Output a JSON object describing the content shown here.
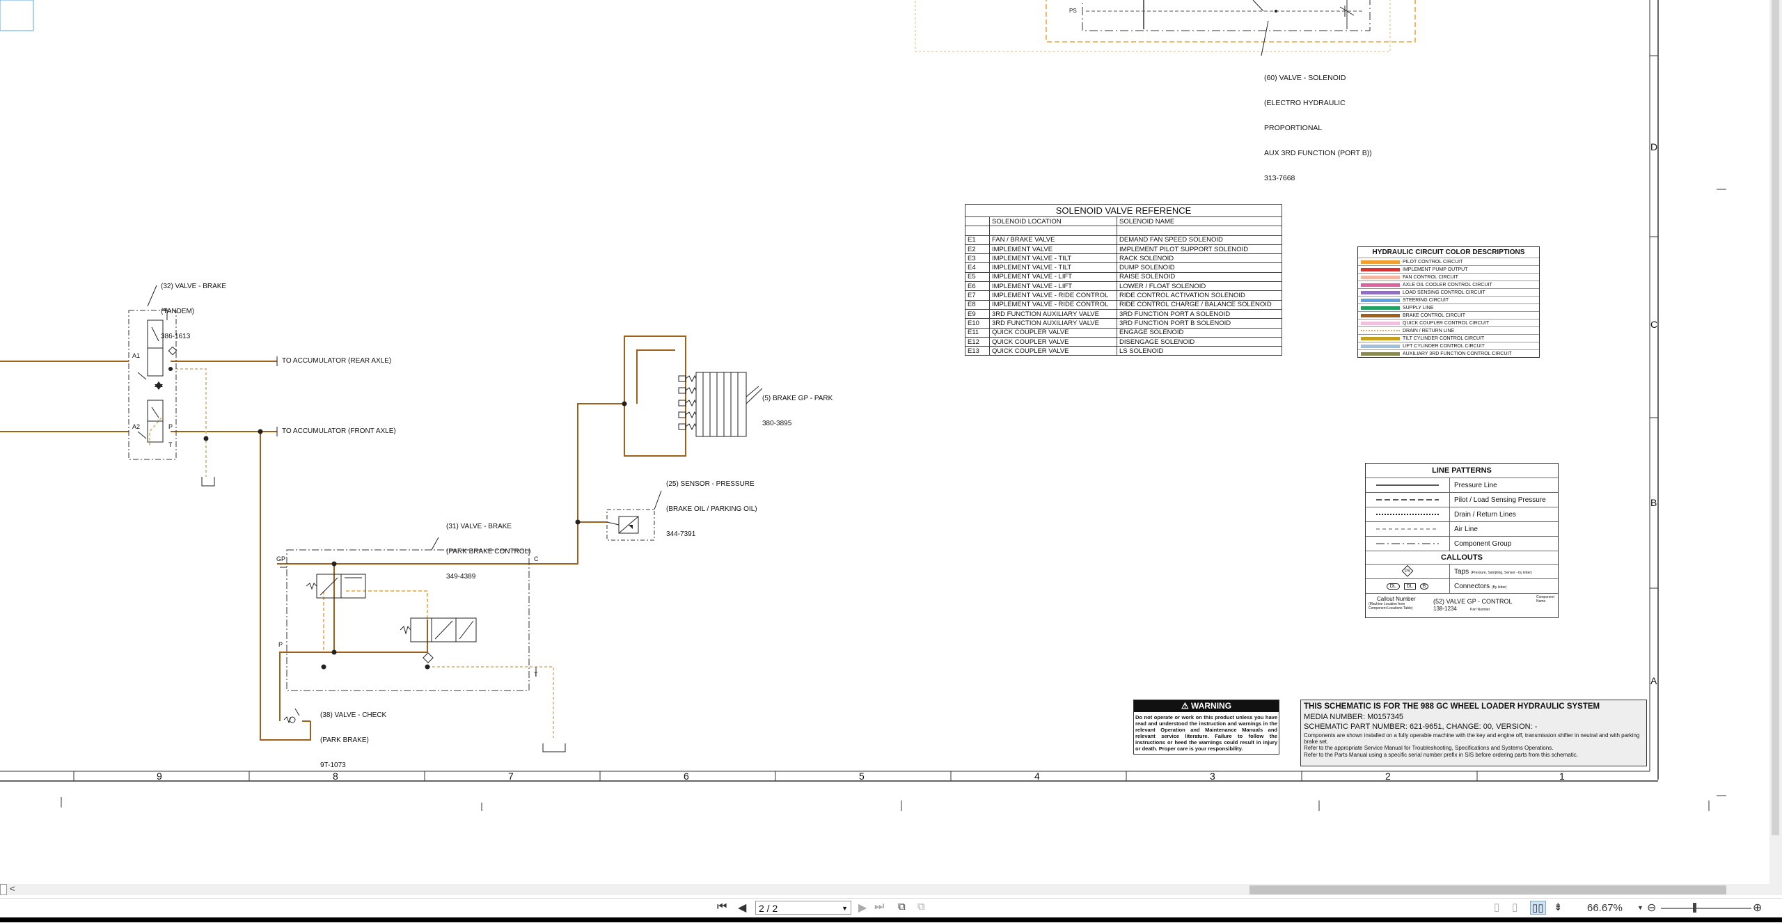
{
  "callouts": {
    "valve_solenoid_60": [
      "(60) VALVE - SOLENOID",
      "(ELECTRO HYDRAULIC",
      "PROPORTIONAL",
      "AUX 3RD FUNCTION (PORT B))",
      "313-7668"
    ],
    "valve_brake_32": [
      "(32) VALVE - BRAKE",
      "(TANDEM)",
      "386-1613"
    ],
    "accum_rear": "TO ACCUMULATOR (REAR AXLE)",
    "accum_front": "TO ACCUMULATOR (FRONT AXLE)",
    "brake_gp_park": [
      "(5) BRAKE GP - PARK",
      "380-3895"
    ],
    "sensor_pressure": [
      "(25) SENSOR - PRESSURE",
      "(BRAKE OIL / PARKING OIL)",
      "344-7391"
    ],
    "valve_brake_31": [
      "(31) VALVE - BRAKE",
      "(PARK BRAKE CONTROL)",
      "349-4389"
    ],
    "valve_check_38": [
      "(38) VALVE - CHECK",
      "(PARK BRAKE)",
      "9T-1073"
    ],
    "ports": {
      "a1": "A1",
      "a2": "A2",
      "p": "P",
      "t": "T",
      "gp": "GP",
      "c": "C",
      "ps": "PS"
    }
  },
  "solenoid_table": {
    "title": "SOLENOID VALVE REFERENCE",
    "col1": "SOLENOID LOCATION",
    "col2": "SOLENOID NAME",
    "rows": [
      [
        "E1",
        "FAN / BRAKE VALVE",
        "DEMAND FAN SPEED SOLENOID"
      ],
      [
        "E2",
        "IMPLEMENT VALVE",
        "IMPLEMENT PILOT SUPPORT SOLENOID"
      ],
      [
        "E3",
        "IMPLEMENT VALVE - TILT",
        "RACK SOLENOID"
      ],
      [
        "E4",
        "IMPLEMENT VALVE - TILT",
        "DUMP SOLENOID"
      ],
      [
        "E5",
        "IMPLEMENT VALVE - LIFT",
        "RAISE SOLENOID"
      ],
      [
        "E6",
        "IMPLEMENT VALVE - LIFT",
        "LOWER / FLOAT SOLENOID"
      ],
      [
        "E7",
        "IMPLEMENT VALVE - RIDE CONTROL",
        "RIDE CONTROL ACTIVATION SOLENOID"
      ],
      [
        "E8",
        "IMPLEMENT VALVE - RIDE CONTROL",
        "RIDE CONTROL CHARGE / BALANCE SOLENOID"
      ],
      [
        "E9",
        "3RD FUNCTION AUXILIARY VALVE",
        "3RD FUNCTION PORT A SOLENOID"
      ],
      [
        "E10",
        "3RD FUNCTION AUXILIARY VALVE",
        "3RD FUNCTION PORT B SOLENOID"
      ],
      [
        "E11",
        "QUICK COUPLER VALVE",
        "ENGAGE SOLENOID"
      ],
      [
        "E12",
        "QUICK COUPLER VALVE",
        "DISENGAGE SOLENOID"
      ],
      [
        "E13",
        "QUICK COUPLER VALVE",
        "LS SOLENOID"
      ]
    ]
  },
  "color_legend": {
    "title": "HYDRAULIC CIRCUIT COLOR DESCRIPTIONS",
    "items": [
      {
        "label": "PILOT CONTROL CIRCUIT",
        "color": "#f0a030"
      },
      {
        "label": "IMPLEMENT PUMP OUTPUT",
        "color": "#e03030"
      },
      {
        "label": "FAN CONTROL CIRCUIT",
        "color": "#f4b6a0"
      },
      {
        "label": "AXLE OIL COOLER CONTROL CIRCUIT",
        "color": "#e060a0"
      },
      {
        "label": "LOAD SENSING CONTROL CIRCUIT",
        "color": "#9070c0"
      },
      {
        "label": "STEERING CIRCUIT",
        "color": "#60a0e0"
      },
      {
        "label": "SUPPLY LINE",
        "color": "#20a060"
      },
      {
        "label": "BRAKE CONTROL CIRCUIT",
        "color": "#a0601a"
      },
      {
        "label": "QUICK COUPLER CONTROL CIRCUIT",
        "color": "#f0c0e0"
      },
      {
        "label": "DRAIN / RETURN LINE",
        "color": "#d0b070"
      },
      {
        "label": "TILT CYLINDER CONTROL CIRCUIT",
        "color": "#c8a020"
      },
      {
        "label": "LIFT CYLINDER CONTROL CIRCUIT",
        "color": "#a0c0e0"
      },
      {
        "label": "AUXILIARY 3RD FUNCTION CONTROL CIRCUIT",
        "color": "#8a8a50"
      }
    ]
  },
  "line_patterns": {
    "title": "LINE PATTERNS",
    "items": [
      "Pressure Line",
      "Pilot / Load Sensing Pressure",
      "Drain / Return Lines",
      "Air Line",
      "Component Group"
    ],
    "callouts_title": "CALLOUTS",
    "taps": "Taps",
    "taps_note": "(Pressure, Sampling, Sensor - by letter)",
    "connectors": "Connectors",
    "connectors_note": "(By letter)",
    "example_callout": "Callout Number",
    "example_callout_note": "(Machine Location from Component Locations Table)",
    "example_name": "(52) VALVE GP - CONTROL",
    "example_part": "138-1234",
    "component_name": "Component Name",
    "part_number": "Part Number",
    "tap_symbol": "PS",
    "conn_symbols": [
      "DL",
      "DL",
      "B"
    ]
  },
  "warning": {
    "title": "WARNING",
    "text": "Do not operate or work on this product unless you have read and understood the instruction and warnings in the relevant Operation and Maintenance Manuals and relevant service literature. Failure to follow the instructions or heed the warnings could result in injury or death. Proper care is your responsibility."
  },
  "title_block": {
    "line1": "THIS SCHEMATIC IS FOR THE 988 GC WHEEL LOADER HYDRAULIC SYSTEM",
    "line2": "MEDIA NUMBER: M0157345",
    "line3": "SCHEMATIC PART NUMBER: 621-9651, CHANGE: 00, VERSION: -",
    "line4": "Components are shown installed on a fully operable machine with the key and engine off, transmission shifter in neutral and with parking brake set.",
    "line5": "Refer to the appropriate Service Manual for Troubleshooting, Specifications and Systems Operations.",
    "line6": "Refer to the Parts Manual using a specific serial number prefix in SIS before ordering parts from this schematic."
  },
  "grid": {
    "columns": [
      "9",
      "8",
      "7",
      "6",
      "5",
      "4",
      "3",
      "2",
      "1"
    ],
    "rows": [
      "D",
      "C",
      "B",
      "A"
    ]
  },
  "viewer": {
    "page_value": "2 / 2",
    "zoom": "66.67%"
  }
}
